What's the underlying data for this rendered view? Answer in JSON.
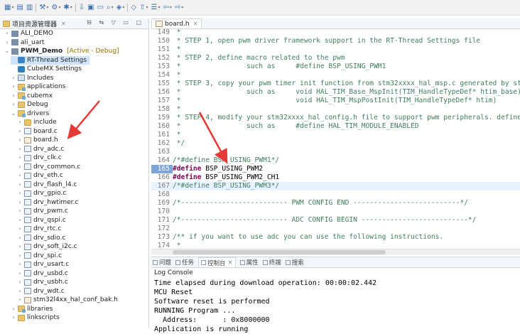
{
  "explorer": {
    "title": "项目资源管理器",
    "close": "✕",
    "actions": "⊟ ⇆ ▽ ▭ ▢",
    "items": [
      {
        "label": "ALI_DEMO",
        "twisty": "›",
        "icon": "proj",
        "indent": 0
      },
      {
        "label": "ali_uart",
        "twisty": "›",
        "icon": "proj",
        "indent": 0
      },
      {
        "label": "PWM_Demo",
        "twisty": "⌄",
        "icon": "proj",
        "indent": 0,
        "bold": true,
        "suffix": "[Active - Debug]"
      },
      {
        "label": "RT-Thread Settings",
        "twisty": "",
        "icon": "rt",
        "indent": 1,
        "selected": true
      },
      {
        "label": "CubeMX Settings",
        "twisty": "",
        "icon": "cube",
        "indent": 1
      },
      {
        "label": "Includes",
        "twisty": "›",
        "icon": "incl",
        "indent": 1
      },
      {
        "label": "applications",
        "twisty": "›",
        "icon": "srcfolder",
        "indent": 1
      },
      {
        "label": "cubemx",
        "twisty": "›",
        "icon": "srcfolder",
        "indent": 1
      },
      {
        "label": "Debug",
        "twisty": "›",
        "icon": "folder",
        "indent": 1
      },
      {
        "label": "drivers",
        "twisty": "⌄",
        "icon": "srcfolder",
        "indent": 1
      },
      {
        "label": "include",
        "twisty": "›",
        "icon": "folder",
        "indent": 2
      },
      {
        "label": "board.c",
        "twisty": "›",
        "icon": "filec",
        "indent": 2
      },
      {
        "label": "board.h",
        "twisty": "›",
        "icon": "fileh",
        "indent": 2
      },
      {
        "label": "drv_adc.c",
        "twisty": "›",
        "icon": "filec",
        "indent": 2
      },
      {
        "label": "drv_clk.c",
        "twisty": "›",
        "icon": "filec",
        "indent": 2
      },
      {
        "label": "drv_common.c",
        "twisty": "›",
        "icon": "filec",
        "indent": 2
      },
      {
        "label": "drv_eth.c",
        "twisty": "›",
        "icon": "filec",
        "indent": 2
      },
      {
        "label": "drv_flash_l4.c",
        "twisty": "›",
        "icon": "filec",
        "indent": 2
      },
      {
        "label": "drv_gpio.c",
        "twisty": "›",
        "icon": "filec",
        "indent": 2
      },
      {
        "label": "drv_hwtimer.c",
        "twisty": "›",
        "icon": "filec",
        "indent": 2
      },
      {
        "label": "drv_pwm.c",
        "twisty": "›",
        "icon": "filec",
        "indent": 2
      },
      {
        "label": "drv_qspi.c",
        "twisty": "›",
        "icon": "filec",
        "indent": 2
      },
      {
        "label": "drv_rtc.c",
        "twisty": "›",
        "icon": "filec",
        "indent": 2
      },
      {
        "label": "drv_sdio.c",
        "twisty": "›",
        "icon": "filec",
        "indent": 2
      },
      {
        "label": "drv_soft_i2c.c",
        "twisty": "›",
        "icon": "filec",
        "indent": 2
      },
      {
        "label": "drv_spi.c",
        "twisty": "›",
        "icon": "filec",
        "indent": 2
      },
      {
        "label": "drv_usart.c",
        "twisty": "›",
        "icon": "filec",
        "indent": 2
      },
      {
        "label": "drv_usbd.c",
        "twisty": "›",
        "icon": "filec",
        "indent": 2
      },
      {
        "label": "drv_usbh.c",
        "twisty": "›",
        "icon": "filec",
        "indent": 2
      },
      {
        "label": "drv_wdt.c",
        "twisty": "›",
        "icon": "filec",
        "indent": 2
      },
      {
        "label": "stm32l4xx_hal_conf_bak.h",
        "twisty": "›",
        "icon": "fileh",
        "indent": 2
      },
      {
        "label": "libraries",
        "twisty": "›",
        "icon": "srcfolder",
        "indent": 1
      },
      {
        "label": "linkscripts",
        "twisty": "›",
        "icon": "folder",
        "indent": 1
      }
    ]
  },
  "editor": {
    "tab_label": "board.h",
    "tab_close": "✕",
    "lines": [
      {
        "n": "149",
        "parts": [
          [
            "cmt",
            " *"
          ]
        ]
      },
      {
        "n": "150",
        "parts": [
          [
            "cmt",
            " * STEP 1, open pwm driver framework support in the RT-Thread Settings file"
          ]
        ]
      },
      {
        "n": "151",
        "parts": [
          [
            "cmt",
            " *"
          ]
        ]
      },
      {
        "n": "152",
        "parts": [
          [
            "cmt",
            " * STEP 2, define macro related to the pwm"
          ]
        ]
      },
      {
        "n": "153",
        "parts": [
          [
            "cmt",
            " *                such as     #define BSP_USING_PWM1"
          ]
        ]
      },
      {
        "n": "154",
        "parts": [
          [
            "cmt",
            " *"
          ]
        ]
      },
      {
        "n": "155",
        "parts": [
          [
            "cmt",
            " * STEP 3, copy your pwm timer init function from stm32xxxx_hal_msp.c generated by stm32"
          ]
        ]
      },
      {
        "n": "156",
        "parts": [
          [
            "cmt",
            " *                such as     void HAL_TIM_Base_MspInit(TIM_HandleTypeDef* htim_base)"
          ]
        ]
      },
      {
        "n": "157",
        "parts": [
          [
            "cmt",
            " *                            void HAL_TIM_MspPostInit(TIM_HandleTypeDef* htim)"
          ]
        ]
      },
      {
        "n": "158",
        "parts": [
          [
            "cmt",
            " *"
          ]
        ]
      },
      {
        "n": "159",
        "parts": [
          [
            "cmt",
            " * STEP 4, modify your stm32xxxx_hal_config.h file to support pwm peripherals. define ma"
          ]
        ]
      },
      {
        "n": "160",
        "parts": [
          [
            "cmt",
            " *                such as     #define HAL_TIM_MODULE_ENABLED"
          ]
        ]
      },
      {
        "n": "161",
        "parts": [
          [
            "cmt",
            " *"
          ]
        ]
      },
      {
        "n": "162",
        "parts": [
          [
            "cmt",
            " */"
          ]
        ]
      },
      {
        "n": "163",
        "parts": [
          [
            "txt",
            ""
          ]
        ]
      },
      {
        "n": "164",
        "parts": [
          [
            "cmt",
            "/*#define BSP_USING_PWM1*/"
          ]
        ]
      },
      {
        "n": "165",
        "parts": [
          [
            "kw",
            "#define"
          ],
          [
            "txt",
            " BSP_USING_PWM2"
          ]
        ],
        "marked": true
      },
      {
        "n": "166",
        "parts": [
          [
            "kw",
            "#define"
          ],
          [
            "txt",
            " BSP_USING_PWM2_CH1"
          ]
        ]
      },
      {
        "n": "167",
        "parts": [
          [
            "cmt",
            "/*#define BSP_USING_PWM3*/"
          ]
        ],
        "highlight": true
      },
      {
        "n": "168",
        "parts": [
          [
            "txt",
            ""
          ]
        ]
      },
      {
        "n": "169",
        "parts": [
          [
            "cmt",
            "/*-------------------------- PWM CONFIG END --------------------------*/"
          ]
        ]
      },
      {
        "n": "170",
        "parts": [
          [
            "txt",
            ""
          ]
        ]
      },
      {
        "n": "171",
        "parts": [
          [
            "cmt",
            "/*-------------------------- ADC CONFIG BEGIN --------------------------*/"
          ]
        ]
      },
      {
        "n": "172",
        "parts": [
          [
            "txt",
            ""
          ]
        ]
      },
      {
        "n": "173",
        "parts": [
          [
            "cmt",
            "/** if you want to use adc you can use the following instructions."
          ]
        ]
      },
      {
        "n": "174",
        "parts": [
          [
            "cmt",
            " *"
          ]
        ]
      }
    ]
  },
  "console": {
    "tabs": [
      {
        "label": "问题",
        "selected": false
      },
      {
        "label": "任务",
        "selected": false
      },
      {
        "label": "控制台",
        "selected": true
      },
      {
        "label": "属性",
        "selected": false
      },
      {
        "label": "终端",
        "selected": false
      },
      {
        "label": "搜索",
        "selected": false
      }
    ],
    "tab_close": "✕",
    "name": "Log Console",
    "output": [
      "Time elapsed during download operation: 00:00:02.442",
      "MCU Reset",
      "Software reset is performed",
      "RUNNING Program ...",
      "  Address:      : 0x8000000",
      "Application is running"
    ]
  },
  "colors": {
    "annotation_arrow": "#e53935",
    "selection": "#cfe4fb",
    "active_label": "#a06d00"
  },
  "toolbar_icons": [
    "new-icon",
    "save-icon",
    "save-all-icon",
    "build-icon",
    "debug-icon",
    "download-icon",
    "run-icon",
    "search-icon",
    "settings-icon",
    "back-icon",
    "forward-icon"
  ]
}
